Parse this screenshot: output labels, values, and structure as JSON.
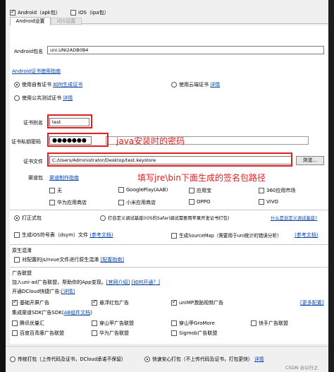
{
  "platform": {
    "android_label": "Android（apk包）",
    "ios_label": "iOS（ipa包）"
  },
  "tabs": [
    "Android设置",
    "iOS设置"
  ],
  "package_name": {
    "label": "Android包名",
    "value": "uni.UNI2ADB0B4"
  },
  "cert_guide_link": "Android证书使用指南",
  "cert_options": {
    "own": "使用自有证书",
    "own_link": "如何生成证书",
    "cloud": "使用云端证书",
    "cloud_link": "详情",
    "public": "使用公共测试证书",
    "public_link": "详情"
  },
  "alias": {
    "label": "证书别名",
    "value": "test"
  },
  "password": {
    "label": "证书私钥密码",
    "value": "●●●●●●●"
  },
  "annotation_password": "java安装时的密码",
  "cert_file": {
    "label": "证书文件",
    "value": "C:/Users/Administrator/Desktop/test.keystore",
    "browse": "浏览..."
  },
  "channel": {
    "label": "渠道包",
    "link": "渠道制作指南",
    "items": [
      "无",
      "GooglePlay(AAB)",
      "应用宝",
      "360应用市场",
      "华为应用商店",
      "小米应用商店",
      "OPPO",
      "VIVO"
    ]
  },
  "annotation_cert": "填写jre\\bin下面生成的签名包路径",
  "package_type": {
    "formal": "打正式包",
    "custom": "打自定义调试基座(iOS的Safari调试需要用苹果开发证书打包)",
    "custom_link": "什么是自定义调试基座?"
  },
  "symbols": {
    "ios_dsym": "生成iOS符号表（dsym）文件",
    "ios_link": "(参考文档)",
    "sourcemap": "生成SourceMap（需要用于uni统计的错误分析）",
    "sourcemap_link": "(参考文档)"
  },
  "obfuscation": {
    "section": "原生混淆",
    "option": "对配置的js/nvue文件进行原生混淆",
    "link": "[配置指南]"
  },
  "ads": {
    "section": "广告联盟",
    "intro": "加入uni-ad广告联盟，帮助你的App变现。",
    "intro_link1": "[官网介绍]",
    "intro_link2": "[如何开通？]",
    "dcloud_label": "开通DCloud快捷广告:",
    "dcloud_link": "[详情]",
    "dcloud_items": [
      "基础开屏广告",
      "悬浮红包广告",
      "uniMP激励视频广告"
    ],
    "dcloud_more": "[更多配置]",
    "sdk_label": "集成渠道SDK广告SDK(",
    "sdk_link": "AB组件文档",
    "sdk_label_end": ")",
    "sdk_items": [
      "腾讯优量汇",
      "穿山甲广告联盟",
      "穿山甲GroMore",
      "快手广告联盟",
      "百度百青藤广告联盟",
      "华为广告联盟",
      "Sigmob广告联盟"
    ]
  },
  "bottom": {
    "traditional": "传统打包（上传代码及证书，DCloud承诺不保留）",
    "fast": "快速安心打包（不上传代码及证书，打包更快）",
    "fast_link": "详情"
  },
  "watermark": "CSDN @以行之"
}
